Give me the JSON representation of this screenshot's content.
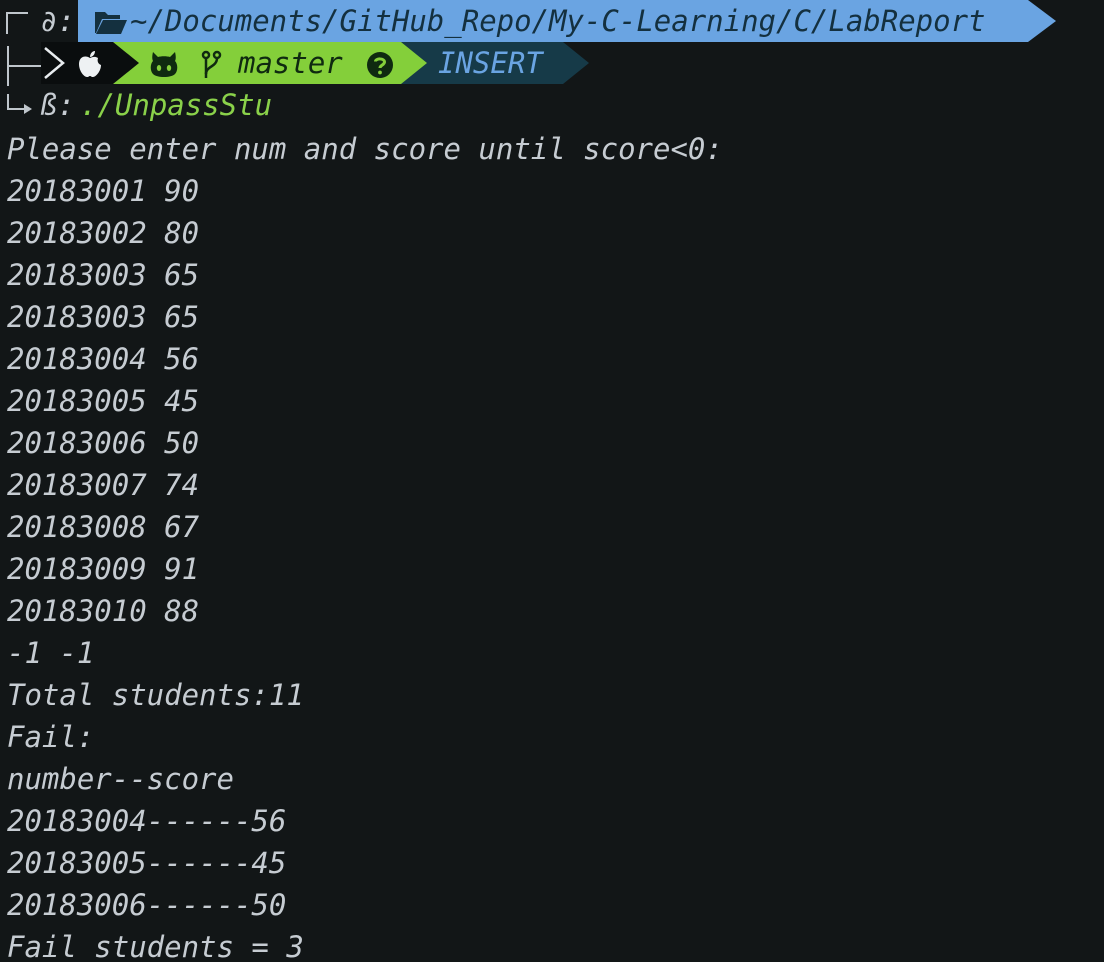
{
  "prompt": {
    "line1_prefix": "∂:",
    "path": "~/Documents/GitHub_Repo/My-C-Learning/C/LabReport",
    "branch": "master",
    "mode": "INSERT",
    "line3_prefix": "ß:",
    "command": "./UnpassStu",
    "colors": {
      "path_bg": "#6aa4e2",
      "git_bg": "#84cf3a",
      "mode_bg": "#163a48",
      "command_fg": "#8ad14a"
    },
    "icons": [
      "folder-icon",
      "apple-icon",
      "github-icon",
      "branch-icon",
      "question-icon"
    ]
  },
  "output": [
    "Please enter num and score until score<0:",
    "20183001 90",
    "20183002 80",
    "20183003 65",
    "20183003 65",
    "20183004 56",
    "20183005 45",
    "20183006 50",
    "20183007 74",
    "20183008 67",
    "20183009 91",
    "20183010 88",
    "-1 -1",
    "Total students:11",
    "Fail:",
    "number--score",
    "20183004------56",
    "20183005------45",
    "20183006------50",
    "Fail students = 3"
  ]
}
